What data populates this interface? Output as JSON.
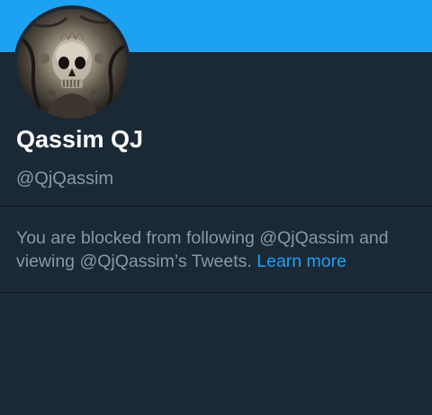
{
  "colors": {
    "banner": "#1da1f2",
    "background": "#1b2836",
    "name": "#ffffff",
    "secondary_text": "#8899a6",
    "link": "#1da1f2"
  },
  "profile": {
    "display_name": "Qassim QJ",
    "handle": "@QjQassim",
    "avatar": "skull-avatar"
  },
  "blocked_notice": {
    "message": "You are blocked from following @QjQassim and viewing @QjQassim’s Tweets.",
    "link_label": "Learn more"
  }
}
